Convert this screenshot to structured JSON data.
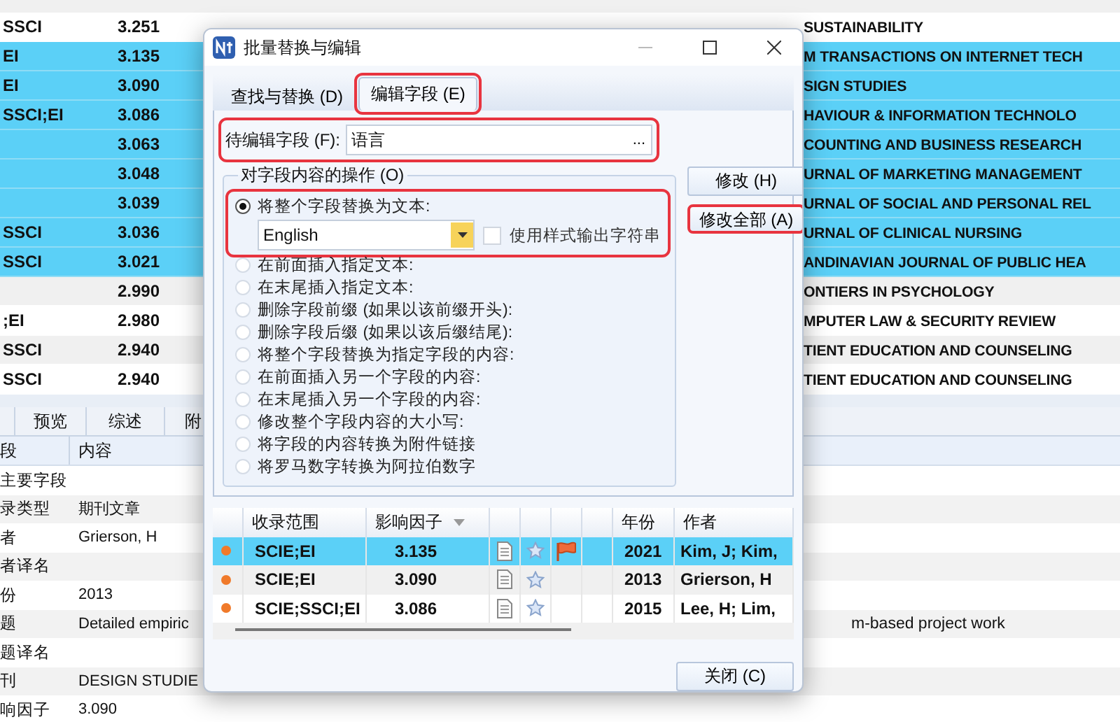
{
  "records_table": {
    "rows": [
      {
        "scope": "SSCI",
        "impact": "3.251",
        "journal": "SUSTAINABILITY",
        "selected": false
      },
      {
        "scope": "EI",
        "impact": "3.135",
        "journal": "M TRANSACTIONS ON INTERNET TECH",
        "selected": true
      },
      {
        "scope": "EI",
        "impact": "3.090",
        "journal": "SIGN STUDIES",
        "selected": true
      },
      {
        "scope": "SSCI;EI",
        "impact": "3.086",
        "journal": "HAVIOUR & INFORMATION TECHNOLO",
        "selected": true
      },
      {
        "impact": "3.063",
        "journal": "COUNTING AND BUSINESS RESEARCH",
        "selected": true
      },
      {
        "impact": "3.048",
        "journal": "URNAL OF MARKETING MANAGEMENT",
        "selected": true
      },
      {
        "impact": "3.039",
        "journal": "URNAL OF SOCIAL AND PERSONAL REL",
        "selected": true
      },
      {
        "scope": "SSCI",
        "impact": "3.036",
        "journal": "URNAL OF CLINICAL NURSING",
        "selected": true
      },
      {
        "scope": "SSCI",
        "impact": "3.021",
        "journal": "ANDINAVIAN JOURNAL OF PUBLIC HEA",
        "selected": true
      },
      {
        "impact": "2.990",
        "journal": "ONTIERS IN PSYCHOLOGY",
        "selected": false
      },
      {
        "scope": ";EI",
        "impact": "2.980",
        "journal": "MPUTER LAW & SECURITY REVIEW",
        "selected": false
      },
      {
        "scope": "SSCI",
        "impact": "2.940",
        "journal": "TIENT EDUCATION AND COUNSELING",
        "selected": false
      },
      {
        "scope": "SSCI",
        "impact": "2.940",
        "journal": "TIENT EDUCATION AND COUNSELING",
        "selected": false
      }
    ]
  },
  "detail_panel": {
    "tabs": [
      {
        "label": "预览",
        "selected": false
      },
      {
        "label": "综述",
        "selected": false
      },
      {
        "label": "附",
        "selected": false
      }
    ],
    "columns": [
      "段",
      "内容"
    ],
    "rows": [
      {
        "kind": "section",
        "field": "主要字段"
      },
      {
        "kind": "field",
        "field": "录类型",
        "value": "期刊文章"
      },
      {
        "kind": "field",
        "field": "者",
        "value": "Grierson, H"
      },
      {
        "kind": "field",
        "field": "者译名"
      },
      {
        "kind": "field",
        "field": "份",
        "value": "2013"
      },
      {
        "kind": "field",
        "field": "题",
        "value": "Detailed empiric",
        "value_continued": "m-based project work"
      },
      {
        "kind": "field",
        "field": "题译名"
      },
      {
        "kind": "field",
        "field": "刊",
        "value": "DESIGN STUDIE"
      },
      {
        "kind": "field",
        "field": "响因子",
        "value": "3.090"
      }
    ]
  },
  "dialog": {
    "title": "批量替换与编辑",
    "tabs": [
      {
        "label": "查找与替换 (D)",
        "selected": false,
        "highlighted": false
      },
      {
        "label": "编辑字段 (E)",
        "selected": true,
        "highlighted": true
      }
    ],
    "field": {
      "label": "待编辑字段 (F):",
      "value": "语言",
      "browse": "...",
      "highlighted": true
    },
    "operations": {
      "title": "对字段内容的操作 (O)",
      "options": [
        {
          "label": "将整个字段替换为文本:",
          "selected": true,
          "highlighted": true,
          "replace_text": "English",
          "style_output": {
            "label": "使用样式输出字符串",
            "checked": false
          }
        },
        {
          "label": "在前面插入指定文本:",
          "selected": false,
          "highlighted": false
        },
        {
          "label": "在末尾插入指定文本:",
          "selected": false,
          "highlighted": false
        },
        {
          "label": "删除字段前缀 (如果以该前缀开头):",
          "selected": false,
          "highlighted": false
        },
        {
          "label": "删除字段后缀 (如果以该后缀结尾):",
          "selected": false,
          "highlighted": false
        },
        {
          "label": "将整个字段替换为指定字段的内容:",
          "selected": false,
          "highlighted": false
        },
        {
          "label": "在前面插入另一个字段的内容:",
          "selected": false,
          "highlighted": false
        },
        {
          "label": "在末尾插入另一个字段的内容:",
          "selected": false,
          "highlighted": false
        },
        {
          "label": "修改整个字段内容的大小写:",
          "selected": false,
          "highlighted": false
        },
        {
          "label": "将字段的内容转换为附件链接",
          "selected": false,
          "highlighted": false
        },
        {
          "label": "将罗马数字转换为阿拉伯数字",
          "selected": false,
          "highlighted": false
        }
      ]
    },
    "buttons": [
      {
        "label": "修改 (H)",
        "highlighted": false
      },
      {
        "label": "修改全部 (A)",
        "highlighted": true
      }
    ],
    "results": {
      "columns": [
        "收录范围",
        "影响因子",
        "年份",
        "作者"
      ],
      "rows": [
        {
          "scope": "SCIE;EI",
          "impact": "3.135",
          "year": "2021",
          "author": "Kim, J; Kim,",
          "flagged": true,
          "selected": true
        },
        {
          "scope": "SCIE;EI",
          "impact": "3.090",
          "year": "2013",
          "author": "Grierson, H",
          "flagged": false,
          "selected": false
        },
        {
          "scope": "SCIE;SSCI;EI",
          "impact": "3.086",
          "year": "2015",
          "author": "Lee, H; Lim,",
          "flagged": false,
          "selected": false
        }
      ]
    },
    "close_button": "关闭 (C)"
  }
}
